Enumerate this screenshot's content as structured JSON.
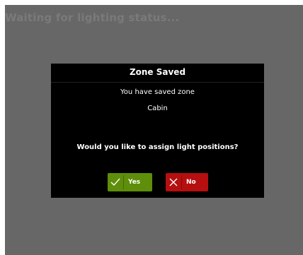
{
  "status": {
    "text": "Waiting for lighting status..."
  },
  "dialog": {
    "title": "Zone Saved",
    "message_line1": "You have saved zone",
    "zone_name": "Cabin",
    "question": "Would you like to assign light positions?",
    "yes_label": "Yes",
    "no_label": "No",
    "yes_icon": "checkmark-icon",
    "no_icon": "close-icon"
  },
  "colors": {
    "background": "#676767",
    "dialog": "#000000",
    "yes_button": "#5e8e0a",
    "no_button": "#b50f0f"
  }
}
